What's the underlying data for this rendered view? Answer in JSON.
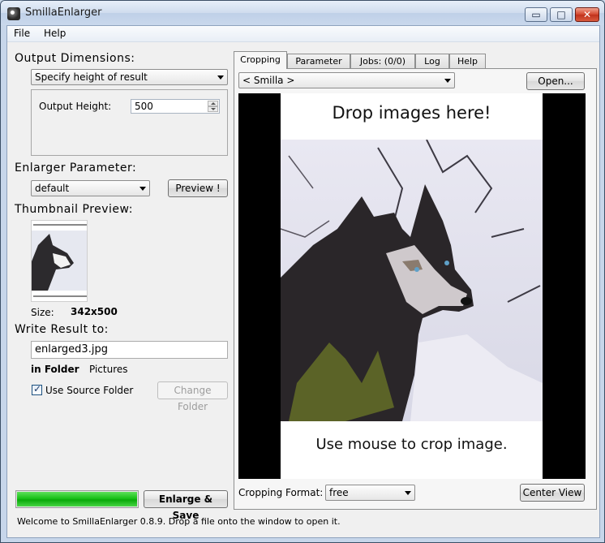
{
  "window": {
    "title": "SmillaEnlarger",
    "min_glyph": "▭",
    "max_glyph": "□",
    "close_glyph": "✕"
  },
  "menu": {
    "file": "File",
    "help": "Help"
  },
  "left": {
    "output_dimensions_title": "Output Dimensions:",
    "dimension_mode": "Specify height of result",
    "output_height_label": "Output Height:",
    "output_height_value": "500",
    "enlarger_parameter_title": "Enlarger Parameter:",
    "parameter_preset": "default",
    "preview_button": "Preview !",
    "thumbnail_title": "Thumbnail Preview:",
    "size_label": "Size:",
    "size_value": "342x500",
    "write_result_title": "Write Result to:",
    "filename": "enlarged3.jpg",
    "in_folder_label": "in Folder",
    "folder_value": "Pictures",
    "use_source_folder_label": "Use Source Folder",
    "use_source_folder_checked": true,
    "change_folder_button": "Change Folder",
    "progress": 1.0,
    "enlarge_save_button": "Enlarge & Save"
  },
  "tabs": [
    {
      "label": "Cropping",
      "active": true
    },
    {
      "label": "Parameter",
      "active": false
    },
    {
      "label": "Jobs: (0/0)",
      "active": false
    },
    {
      "label": "Log",
      "active": false
    },
    {
      "label": "Help",
      "active": false
    }
  ],
  "cropping": {
    "image_select": "< Smilla >",
    "open_button": "Open...",
    "drop_text": "Drop images here!",
    "crop_hint": "Use mouse to crop image.",
    "format_label": "Cropping Format:",
    "format_value": "free",
    "center_view_button": "Center View"
  },
  "status": "Welcome to SmillaEnlarger 0.8.9.  Drop a file onto the window to open it."
}
